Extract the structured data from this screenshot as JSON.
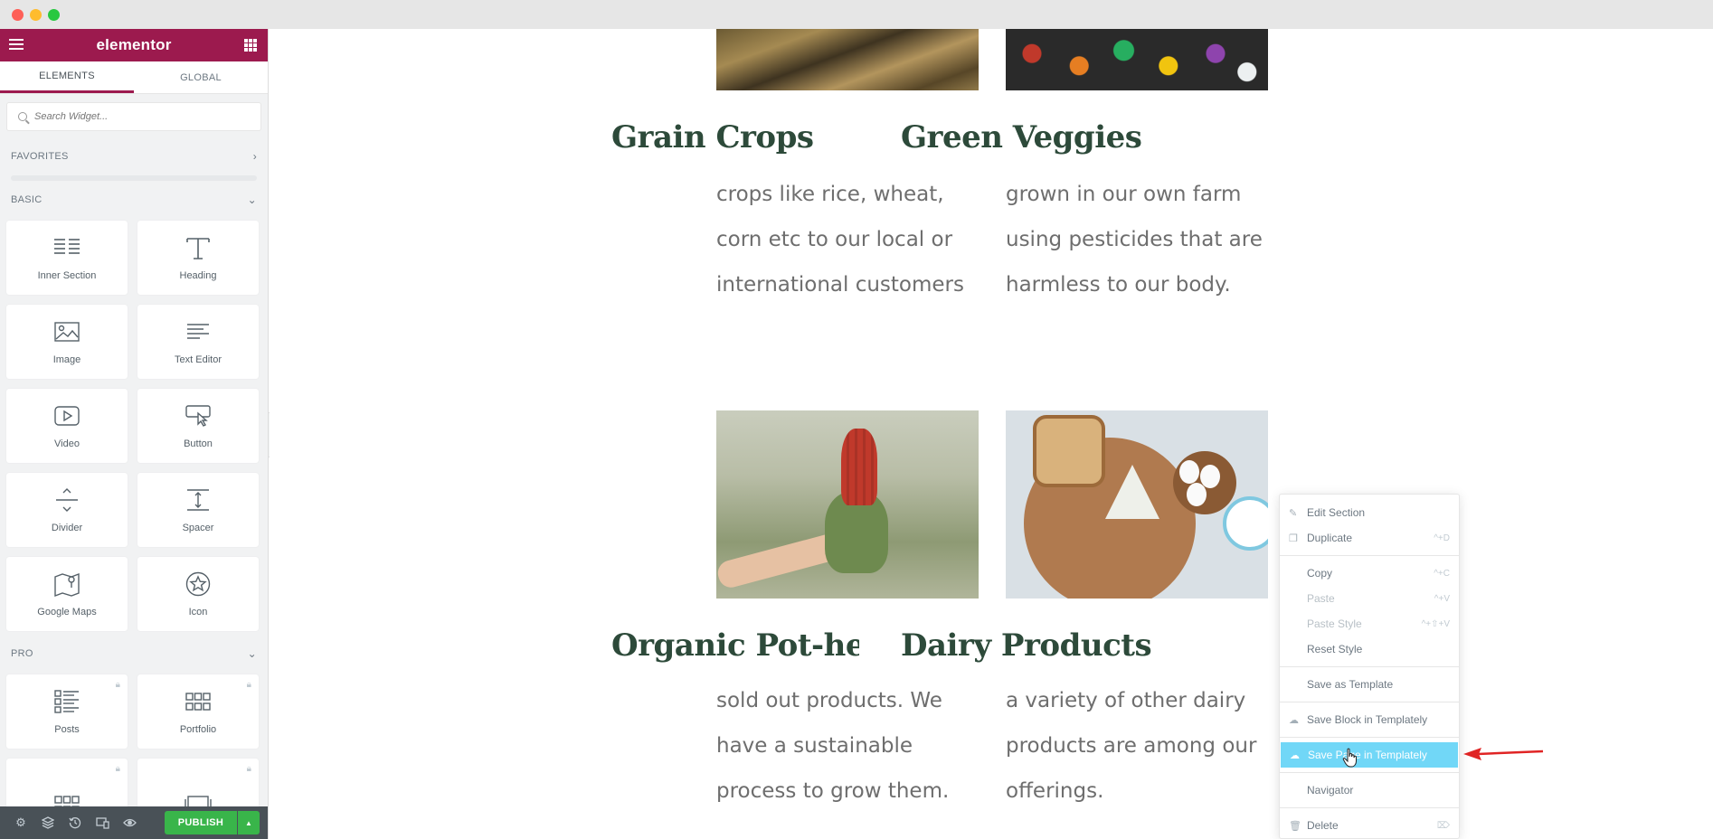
{
  "window": {
    "traffic_lights": [
      "close",
      "minimize",
      "zoom"
    ]
  },
  "sidebar": {
    "logo": "elementor",
    "tabs": [
      {
        "label": "ELEMENTS",
        "active": true
      },
      {
        "label": "GLOBAL",
        "active": false
      }
    ],
    "search_placeholder": "Search Widget...",
    "favorites_label": "FAVORITES",
    "basic_label": "BASIC",
    "pro_label": "PRO",
    "basic_widgets": [
      {
        "label": "Inner Section",
        "icon": "inner-section-icon"
      },
      {
        "label": "Heading",
        "icon": "heading-icon"
      },
      {
        "label": "Image",
        "icon": "image-icon"
      },
      {
        "label": "Text Editor",
        "icon": "text-editor-icon"
      },
      {
        "label": "Video",
        "icon": "video-icon"
      },
      {
        "label": "Button",
        "icon": "button-icon"
      },
      {
        "label": "Divider",
        "icon": "divider-icon"
      },
      {
        "label": "Spacer",
        "icon": "spacer-icon"
      },
      {
        "label": "Google Maps",
        "icon": "google-maps-icon"
      },
      {
        "label": "Icon",
        "icon": "star-icon"
      }
    ],
    "pro_widgets": [
      {
        "label": "Posts",
        "icon": "posts-icon",
        "locked": true
      },
      {
        "label": "Portfolio",
        "icon": "portfolio-icon",
        "locked": true
      }
    ],
    "footer": {
      "publish_label": "PUBLISH",
      "icons": [
        "settings-icon",
        "layers-icon",
        "history-icon",
        "responsive-icon",
        "preview-icon"
      ]
    }
  },
  "canvas": {
    "cards": [
      {
        "title": "Grain Crops",
        "lines": [
          "crops like rice, wheat,",
          "corn etc to our local or",
          "international customers"
        ]
      },
      {
        "title": "Green Veggies",
        "lines": [
          "grown in our own farm",
          "using pesticides that are",
          "harmless to our body."
        ]
      },
      {
        "title": "Organic Pot-herl",
        "lines": [
          "sold out products. We",
          "have a sustainable",
          "process to grow them."
        ]
      },
      {
        "title": "Dairy Products",
        "lines": [
          "a variety of other dairy",
          "products are among our",
          "offerings."
        ]
      }
    ]
  },
  "context_menu": {
    "items": [
      {
        "label": "Edit Section",
        "shortcut": "",
        "disabled": false,
        "icon": "pencil-icon"
      },
      {
        "label": "Duplicate",
        "shortcut": "^+D",
        "disabled": false,
        "icon": "duplicate-icon"
      },
      {
        "label": "Copy",
        "shortcut": "^+C",
        "disabled": false
      },
      {
        "label": "Paste",
        "shortcut": "^+V",
        "disabled": true
      },
      {
        "label": "Paste Style",
        "shortcut": "^+⇧+V",
        "disabled": true
      },
      {
        "label": "Reset Style",
        "shortcut": "",
        "disabled": false
      },
      {
        "label": "Save as Template",
        "shortcut": "",
        "disabled": false
      },
      {
        "label": "Save Block in Templately",
        "shortcut": "",
        "disabled": false,
        "icon": "cloud-icon"
      },
      {
        "label": "Save Page in Templately",
        "shortcut": "",
        "disabled": false,
        "icon": "cloud-icon",
        "highlighted": true
      },
      {
        "label": "Navigator",
        "shortcut": "",
        "disabled": false
      },
      {
        "label": "Delete",
        "shortcut": "⌦",
        "disabled": false,
        "icon": "trash-icon"
      }
    ],
    "highlight_color": "#71d7f7"
  },
  "colors": {
    "brand": "#9c1a4e",
    "publish": "#39b54a",
    "heading": "#2d4a3a",
    "annotation_arrow": "#e02424"
  }
}
